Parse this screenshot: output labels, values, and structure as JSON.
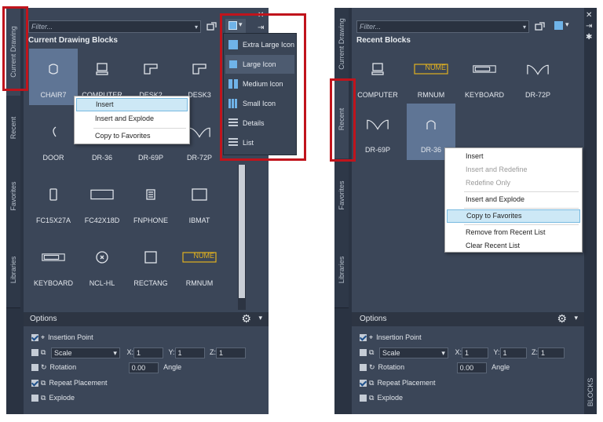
{
  "left": {
    "filter_placeholder": "Filter...",
    "section_title": "Current Drawing Blocks",
    "tabs": [
      "Current Drawing",
      "Recent",
      "Favorites",
      "Libraries"
    ],
    "blocks": [
      {
        "name": "CHAIR7",
        "icon": "chair-icon"
      },
      {
        "name": "COMPUTER",
        "icon": "computer-icon"
      },
      {
        "name": "DESK2",
        "icon": "desk-icon"
      },
      {
        "name": "DESK3",
        "icon": "desk-icon"
      },
      {
        "name": "DOOR",
        "icon": "door-icon"
      },
      {
        "name": "DR-36",
        "icon": "door-swing-icon"
      },
      {
        "name": "DR-69P",
        "icon": "double-door-icon"
      },
      {
        "name": "DR-72P",
        "icon": "double-door-icon"
      },
      {
        "name": "FC15X27A",
        "icon": "cabinet-icon"
      },
      {
        "name": "FC42X18D",
        "icon": "cabinet-wide-icon"
      },
      {
        "name": "FNPHONE",
        "icon": "phone-icon"
      },
      {
        "name": "IBMAT",
        "icon": "mat-icon"
      },
      {
        "name": "KEYBOARD",
        "icon": "keyboard-icon"
      },
      {
        "name": "NCL-HL",
        "icon": "light-icon"
      },
      {
        "name": "RECTANG",
        "icon": "rectangle-icon"
      },
      {
        "name": "RMNUM",
        "icon": "room-number-icon"
      },
      {
        "name": "",
        "icon": "sink-icon"
      },
      {
        "name": "",
        "icon": "plant-icon"
      }
    ],
    "context_menu": [
      "Insert",
      "Insert and Explode",
      "Copy to Favorites"
    ],
    "view_menu": [
      "Extra Large Icon",
      "Large Icon",
      "Medium Icon",
      "Small Icon",
      "Details",
      "List"
    ],
    "rmnum_label": "NUME"
  },
  "right": {
    "filter_placeholder": "Filter...",
    "section_title": "Recent Blocks",
    "tabs": [
      "Current Drawing",
      "Recent",
      "Favorites",
      "Libraries"
    ],
    "blocks": [
      {
        "name": "COMPUTER",
        "icon": "computer-icon"
      },
      {
        "name": "RMNUM",
        "icon": "room-number-icon"
      },
      {
        "name": "KEYBOARD",
        "icon": "keyboard-icon"
      },
      {
        "name": "DR-72P",
        "icon": "double-door-icon"
      },
      {
        "name": "DR-69P",
        "icon": "double-door-icon"
      },
      {
        "name": "DR-36",
        "icon": "door-swing-icon"
      }
    ],
    "context_menu": [
      "Insert",
      "Insert and Redefine",
      "Redefine Only",
      "Insert and Explode",
      "Copy to Favorites",
      "Remove from Recent List",
      "Clear Recent List"
    ],
    "rmnum_label": "NUME",
    "side_label": "BLOCKS"
  },
  "options": {
    "title": "Options",
    "insertion_point": "Insertion Point",
    "scale": "Scale",
    "x_label": "X:",
    "x_value": "1",
    "y_label": "Y:",
    "y_value": "1",
    "z_label": "Z:",
    "z_value": "1",
    "rotation": "Rotation",
    "angle_value": "0.00",
    "angle_label": "Angle",
    "repeat_placement": "Repeat Placement",
    "explode": "Explode"
  },
  "colors": {
    "highlight_box": "#c0141c",
    "selected_tile": "#5f7595",
    "panel": "#3b4658"
  }
}
